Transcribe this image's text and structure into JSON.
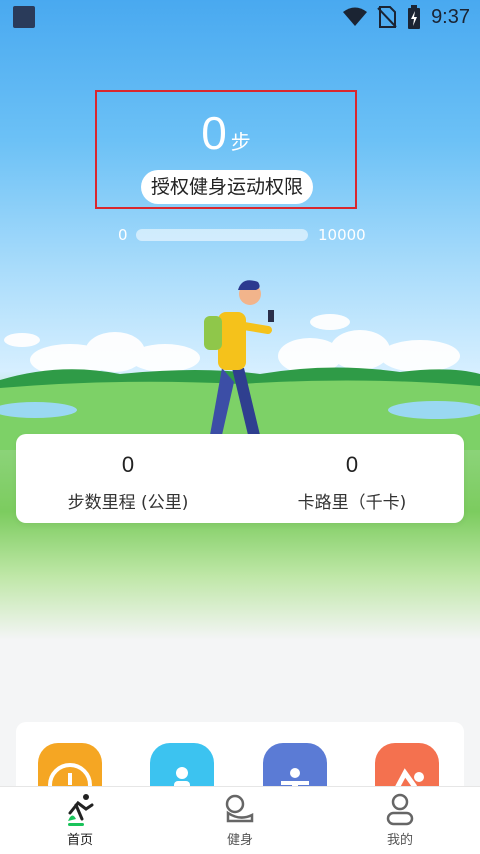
{
  "status_bar": {
    "time": "9:37"
  },
  "hero": {
    "step_count": "0",
    "step_unit": "步",
    "auth_button_label": "授权健身运动权限"
  },
  "progress": {
    "min_label": "0",
    "max_label": "10000",
    "fraction": 0
  },
  "stats": [
    {
      "value": "0",
      "label": "步数里程 (公里)"
    },
    {
      "value": "0",
      "label": "卡路里（千卡)"
    }
  ],
  "apps": [
    {
      "icon": "scale-icon",
      "color": "#f5a623"
    },
    {
      "icon": "body-icon",
      "color": "#3cc3f0"
    },
    {
      "icon": "exercise-icon",
      "color": "#5b7bd5"
    },
    {
      "icon": "yoga-icon",
      "color": "#f4714f"
    }
  ],
  "tabs": [
    {
      "label": "首页",
      "icon": "running-icon",
      "active": true
    },
    {
      "label": "健身",
      "icon": "fitness-icon",
      "active": false
    },
    {
      "label": "我的",
      "icon": "profile-icon",
      "active": false
    }
  ],
  "colors": {
    "accent_green": "#19c35a",
    "sky_blue": "#49a9f0"
  }
}
